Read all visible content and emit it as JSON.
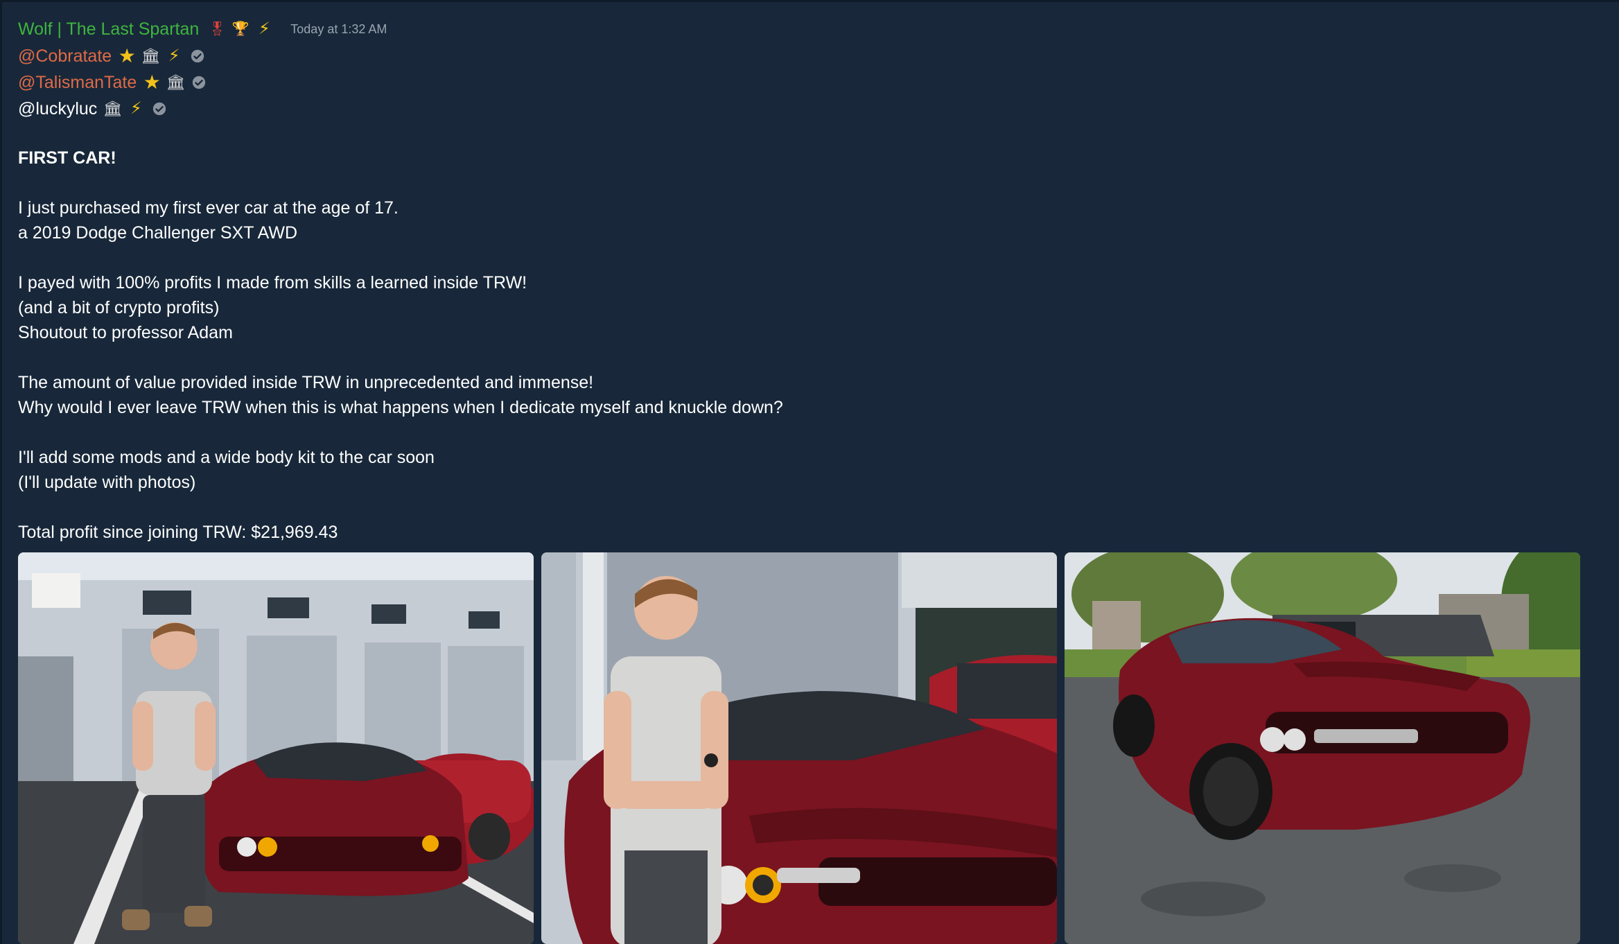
{
  "message": {
    "author": "Wolf | The Last Spartan",
    "author_badges": [
      "medal-icon",
      "trophy-icon",
      "lightning-icon"
    ],
    "timestamp": "Today at 1:32 AM",
    "mentions": [
      {
        "name": "@Cobratate",
        "color": "#e06a47",
        "badges": [
          "star-icon",
          "bank-icon",
          "lightning-icon",
          "verified-icon"
        ]
      },
      {
        "name": "@TalismanTate",
        "color": "#e06a47",
        "badges": [
          "star-icon",
          "bank-icon",
          "verified-icon"
        ]
      },
      {
        "name": "@luckyluc",
        "color": "#ffffff",
        "badges": [
          "bank-icon",
          "lightning-icon",
          "verified-icon"
        ]
      }
    ],
    "lines": [
      "FIRST CAR!",
      "",
      "I just purchased my first ever car at the age of 17.",
      "a 2019 Dodge Challenger SXT AWD",
      "",
      "I payed with 100% profits I made from skills a learned inside TRW!",
      "(and a bit of crypto profits)",
      "Shoutout to professor Adam",
      "",
      "The amount of value provided inside TRW in unprecedented and immense!",
      "Why would I ever leave TRW when this is what happens when I dedicate myself and knuckle down?",
      "",
      "I'll add some mods and a wide body kit to the car soon",
      "(I'll update with photos)",
      "",
      "Total profit since joining TRW: $21,969.43"
    ],
    "attachments": [
      {
        "name": "photo-man-with-car-parking-lot"
      },
      {
        "name": "photo-man-with-car-closeup"
      },
      {
        "name": "photo-car-driveway"
      }
    ]
  },
  "colors": {
    "background": "#18283a",
    "username": "#3fb43f",
    "mention": "#e06a47",
    "timestamp": "#9aa4b0",
    "car_red": "#7a1420"
  }
}
